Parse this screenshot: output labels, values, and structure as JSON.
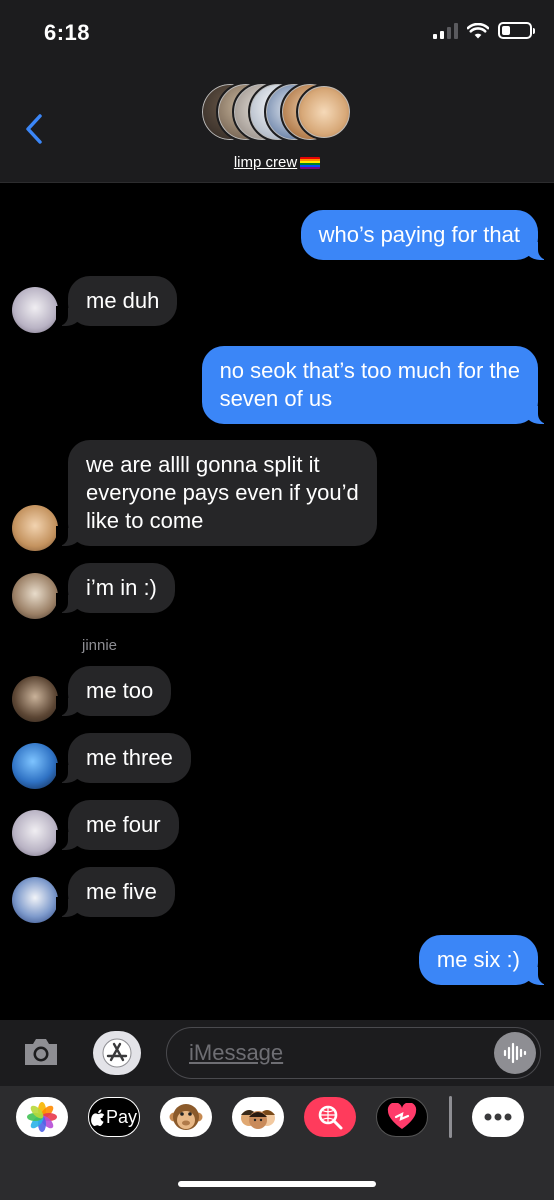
{
  "status_bar": {
    "time": "6:18",
    "battery_level": 0.3
  },
  "header": {
    "group_name": "limp crew",
    "group_emoji": "rainbow-flag"
  },
  "messages": [
    {
      "type": "sent",
      "text": "who’s paying for that"
    },
    {
      "type": "received",
      "text": "me duh"
    },
    {
      "type": "sent",
      "text": "no seok that’s too much for the\nseven of us"
    },
    {
      "type": "received",
      "text": "we are allll gonna split it\neveryone pays even if you’d\nlike to come"
    },
    {
      "type": "received",
      "text": "i’m in :)"
    },
    {
      "type": "received",
      "sender": "jinnie",
      "text": "me too"
    },
    {
      "type": "received",
      "text": "me three"
    },
    {
      "type": "received",
      "text": "me four"
    },
    {
      "type": "received",
      "text": "me five"
    },
    {
      "type": "sent",
      "text": "me six :)"
    }
  ],
  "input": {
    "placeholder": "iMessage"
  },
  "app_drawer": {
    "apple_pay_label": "Pay",
    "icons": [
      "photos-icon",
      "apple-pay-icon",
      "animoji-icon",
      "memoji-icon",
      "web-images-icon",
      "digital-touch-icon",
      "more-icon"
    ]
  },
  "colors": {
    "sent_bubble": "#3b86f7",
    "received_bubble": "#262628",
    "header_bg": "#1c1c1e"
  }
}
